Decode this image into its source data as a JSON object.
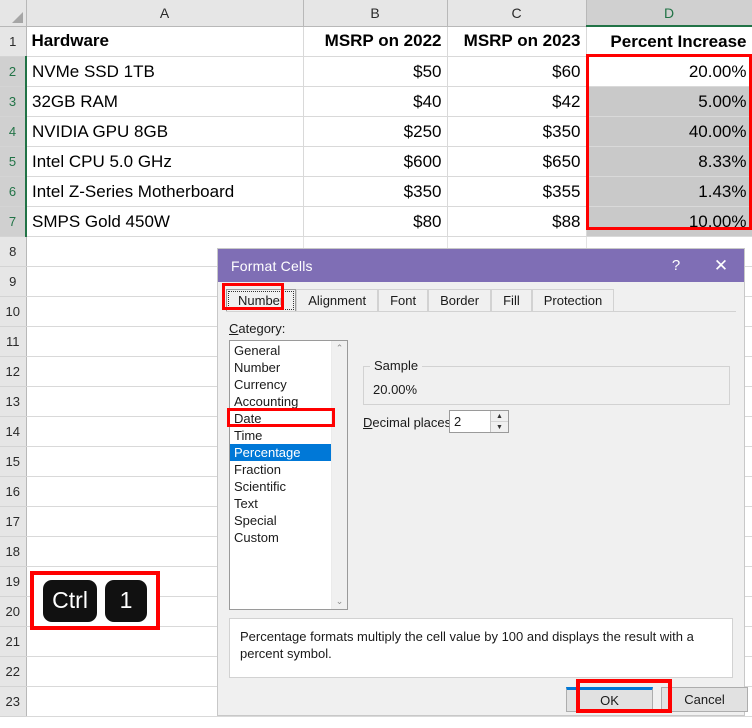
{
  "spreadsheet": {
    "column_headers": [
      "A",
      "B",
      "C",
      "D"
    ],
    "selected_column": "D",
    "row_headers": [
      "1",
      "2",
      "3",
      "4",
      "5",
      "6",
      "7",
      "8",
      "9",
      "10",
      "11",
      "12",
      "13",
      "14",
      "15",
      "16",
      "17",
      "18",
      "19",
      "20",
      "21",
      "22",
      "23"
    ],
    "selected_rows": [
      "2",
      "3",
      "4",
      "5",
      "6",
      "7"
    ],
    "header_row": [
      "Hardware",
      "MSRP on 2022",
      "MSRP on 2023",
      "Percent Increase"
    ],
    "rows": [
      {
        "a": "NVMe SSD 1TB",
        "b": "$50",
        "c": "$60",
        "d": "20.00%"
      },
      {
        "a": "32GB RAM",
        "b": "$40",
        "c": "$42",
        "d": "5.00%"
      },
      {
        "a": "NVIDIA GPU 8GB",
        "b": "$250",
        "c": "$350",
        "d": "40.00%"
      },
      {
        "a": "Intel CPU 5.0 GHz",
        "b": "$600",
        "c": "$650",
        "d": "8.33%"
      },
      {
        "a": "Intel Z-Series Motherboard",
        "b": "$350",
        "c": "$355",
        "d": "1.43%"
      },
      {
        "a": "SMPS Gold 450W",
        "b": "$80",
        "c": "$88",
        "d": "10.00%"
      }
    ],
    "active_cell": "D2",
    "selection_highlight_color": "#ff0000",
    "selection_fill_color": "#c9c9c9",
    "header_accent_color": "#217346"
  },
  "shortcut_overlay": {
    "keys": [
      "Ctrl",
      "1"
    ],
    "box_color": "#ff0000"
  },
  "dialog": {
    "title": "Format Cells",
    "help_icon": "?",
    "close_icon": "✕",
    "titlebar_color": "#7f6eb5",
    "tabs": [
      {
        "label": "Number",
        "active": true
      },
      {
        "label": "Alignment",
        "active": false
      },
      {
        "label": "Font",
        "active": false
      },
      {
        "label": "Border",
        "active": false
      },
      {
        "label": "Fill",
        "active": false
      },
      {
        "label": "Protection",
        "active": false
      }
    ],
    "category_label_pre": "C",
    "category_label_post": "ategory:",
    "categories": [
      {
        "label": "General",
        "selected": false
      },
      {
        "label": "Number",
        "selected": false
      },
      {
        "label": "Currency",
        "selected": false
      },
      {
        "label": "Accounting",
        "selected": false
      },
      {
        "label": "Date",
        "selected": false
      },
      {
        "label": "Time",
        "selected": false
      },
      {
        "label": "Percentage",
        "selected": true
      },
      {
        "label": "Fraction",
        "selected": false
      },
      {
        "label": "Scientific",
        "selected": false
      },
      {
        "label": "Text",
        "selected": false
      },
      {
        "label": "Special",
        "selected": false
      },
      {
        "label": "Custom",
        "selected": false
      }
    ],
    "scroll_up_icon": "⌃",
    "scroll_down_icon": "⌄",
    "sample_legend": "Sample",
    "sample_value": "20.00%",
    "decimal_label_pre": "D",
    "decimal_label_post": "ecimal places:",
    "decimal_places": "2",
    "spin_up_icon": "▲",
    "spin_down_icon": "▼",
    "description": "Percentage formats multiply the cell value by 100 and displays the result with a percent symbol.",
    "ok_label": "OK",
    "cancel_label": "Cancel",
    "selected_category_color": "#0078d7"
  }
}
